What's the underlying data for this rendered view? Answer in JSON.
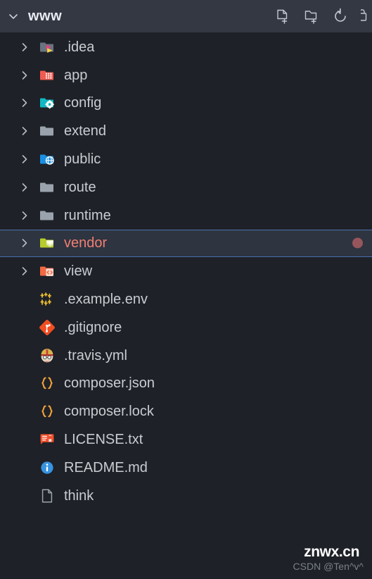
{
  "header": {
    "title": "www",
    "chevron_icon": "chevron-down-icon",
    "actions": [
      {
        "name": "new-file-button",
        "icon": "new-file-icon",
        "label": "New File"
      },
      {
        "name": "new-folder-button",
        "icon": "new-folder-icon",
        "label": "New Folder"
      },
      {
        "name": "refresh-button",
        "icon": "refresh-icon",
        "label": "Refresh"
      },
      {
        "name": "collapse-all-button",
        "icon": "collapse-all-icon",
        "label": "Collapse All"
      }
    ]
  },
  "colors": {
    "header_background": "#343843",
    "tree_background": "#1e2127",
    "selection_background": "#2e3440",
    "selection_border": "#4b6eaf",
    "selected_text": "#f07f72",
    "default_text": "#c9ccd1",
    "status_dot": "#96565c"
  },
  "tree": {
    "items": [
      {
        "name": "idea",
        "label": ".idea",
        "type": "folder",
        "icon": "folder-idea-icon",
        "expandable": true,
        "selected": false
      },
      {
        "name": "app",
        "label": "app",
        "type": "folder",
        "icon": "folder-app-icon",
        "expandable": true,
        "selected": false
      },
      {
        "name": "config",
        "label": "config",
        "type": "folder",
        "icon": "folder-config-icon",
        "expandable": true,
        "selected": false
      },
      {
        "name": "extend",
        "label": "extend",
        "type": "folder",
        "icon": "folder-plain-icon",
        "expandable": true,
        "selected": false
      },
      {
        "name": "public",
        "label": "public",
        "type": "folder",
        "icon": "folder-public-icon",
        "expandable": true,
        "selected": false
      },
      {
        "name": "route",
        "label": "route",
        "type": "folder",
        "icon": "folder-plain-icon",
        "expandable": true,
        "selected": false
      },
      {
        "name": "runtime",
        "label": "runtime",
        "type": "folder",
        "icon": "folder-plain-icon",
        "expandable": true,
        "selected": false
      },
      {
        "name": "vendor",
        "label": "vendor",
        "type": "folder",
        "icon": "folder-vendor-icon",
        "expandable": true,
        "selected": true,
        "status_dot": true
      },
      {
        "name": "view",
        "label": "view",
        "type": "folder",
        "icon": "folder-view-icon",
        "expandable": true,
        "selected": false
      },
      {
        "name": "example-env",
        "label": ".example.env",
        "type": "file",
        "icon": "env-settings-icon",
        "expandable": false,
        "selected": false
      },
      {
        "name": "gitignore",
        "label": ".gitignore",
        "type": "file",
        "icon": "git-icon",
        "expandable": false,
        "selected": false
      },
      {
        "name": "travis-yml",
        "label": ".travis.yml",
        "type": "file",
        "icon": "travis-ci-icon",
        "expandable": false,
        "selected": false
      },
      {
        "name": "composer-json",
        "label": "composer.json",
        "type": "file",
        "icon": "json-braces-icon",
        "expandable": false,
        "selected": false
      },
      {
        "name": "composer-lock",
        "label": "composer.lock",
        "type": "file",
        "icon": "json-braces-icon",
        "expandable": false,
        "selected": false
      },
      {
        "name": "license-txt",
        "label": "LICENSE.txt",
        "type": "file",
        "icon": "license-icon",
        "expandable": false,
        "selected": false
      },
      {
        "name": "readme-md",
        "label": "README.md",
        "type": "file",
        "icon": "info-icon",
        "expandable": false,
        "selected": false
      },
      {
        "name": "think",
        "label": "think",
        "type": "file",
        "icon": "generic-file-icon",
        "expandable": false,
        "selected": false
      }
    ]
  },
  "watermarks": {
    "primary": "znwx.cn",
    "secondary": "CSDN @Ten^v^"
  }
}
